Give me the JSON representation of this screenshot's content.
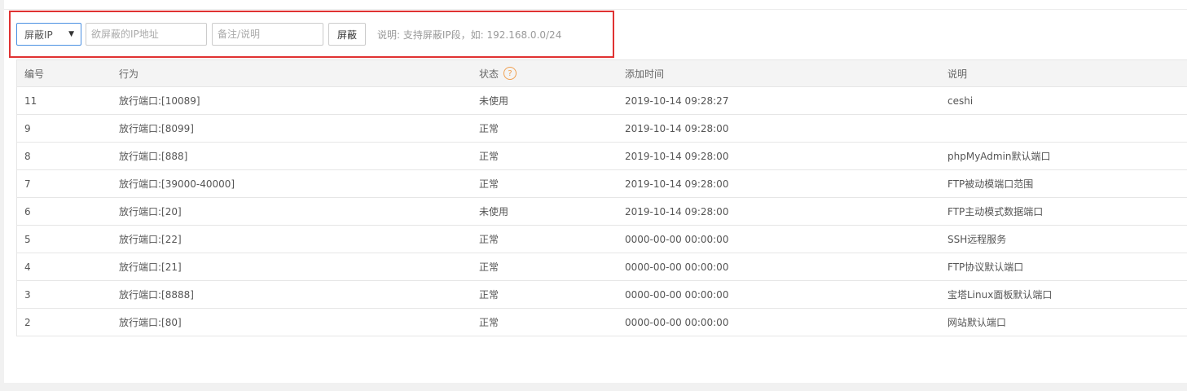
{
  "toolbar": {
    "select_value": "屏蔽IP",
    "ip_placeholder": "欲屏蔽的IP地址",
    "note_placeholder": "备注/说明",
    "button_label": "屏蔽",
    "hint": "说明: 支持屏蔽IP段，如: 192.168.0.0/24"
  },
  "table": {
    "headers": {
      "id": "编号",
      "action": "行为",
      "status": "状态",
      "time": "添加时间",
      "note": "说明"
    },
    "help_icon_glyph": "?",
    "rows": [
      {
        "id": "11",
        "action": "放行端口:[10089]",
        "status": "未使用",
        "time": "2019-10-14 09:28:27",
        "note": "ceshi"
      },
      {
        "id": "9",
        "action": "放行端口:[8099]",
        "status": "正常",
        "time": "2019-10-14 09:28:00",
        "note": ""
      },
      {
        "id": "8",
        "action": "放行端口:[888]",
        "status": "正常",
        "time": "2019-10-14 09:28:00",
        "note": "phpMyAdmin默认端口"
      },
      {
        "id": "7",
        "action": "放行端口:[39000-40000]",
        "status": "正常",
        "time": "2019-10-14 09:28:00",
        "note": "FTP被动模端口范围"
      },
      {
        "id": "6",
        "action": "放行端口:[20]",
        "status": "未使用",
        "time": "2019-10-14 09:28:00",
        "note": "FTP主动模式数据端口"
      },
      {
        "id": "5",
        "action": "放行端口:[22]",
        "status": "正常",
        "time": "0000-00-00 00:00:00",
        "note": "SSH远程服务"
      },
      {
        "id": "4",
        "action": "放行端口:[21]",
        "status": "正常",
        "time": "0000-00-00 00:00:00",
        "note": "FTP协议默认端口"
      },
      {
        "id": "3",
        "action": "放行端口:[8888]",
        "status": "正常",
        "time": "0000-00-00 00:00:00",
        "note": "宝塔Linux面板默认端口"
      },
      {
        "id": "2",
        "action": "放行端口:[80]",
        "status": "正常",
        "time": "0000-00-00 00:00:00",
        "note": "网站默认端口"
      }
    ]
  },
  "colors": {
    "highlight": "#e03232",
    "select_border": "#4a90e2",
    "help_icon": "#f0a050"
  }
}
